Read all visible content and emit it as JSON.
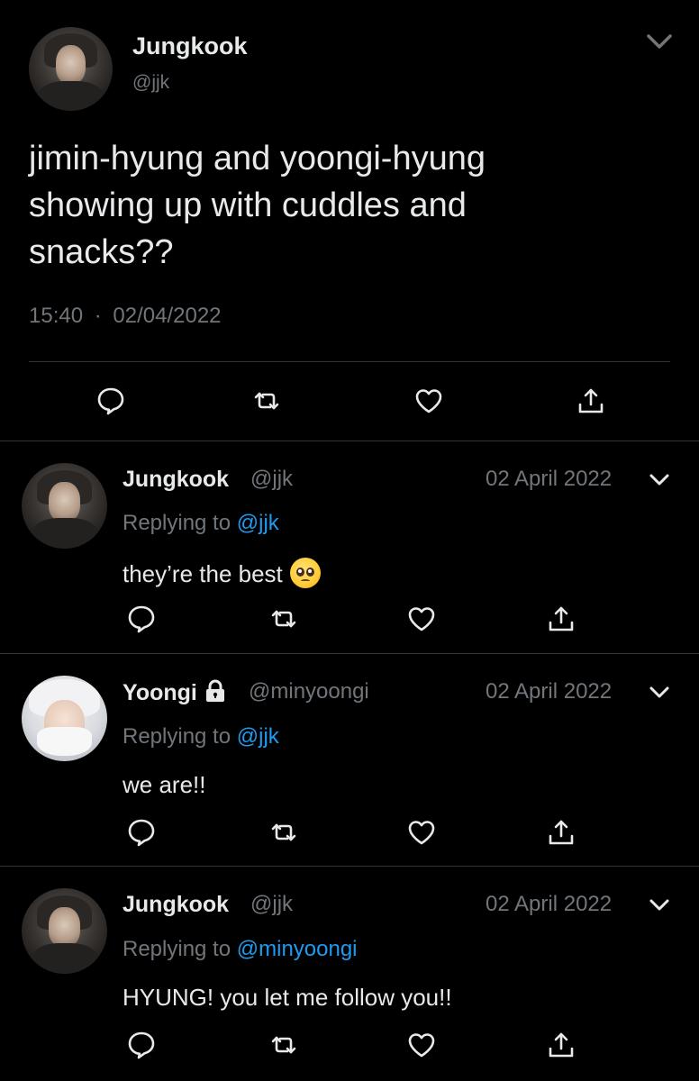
{
  "main_tweet": {
    "author_name": "Jungkook",
    "author_handle": "@jjk",
    "text_lines": [
      "jimin-hyung and yoongi-hyung",
      "showing up with cuddles and",
      "snacks??"
    ],
    "time": "15:40",
    "separator": "·",
    "date": "02/04/2022",
    "actions": [
      "reply-icon",
      "retweet-icon",
      "like-icon",
      "share-icon"
    ]
  },
  "replies": [
    {
      "author_name": "Jungkook",
      "author_handle": "@jjk",
      "locked": false,
      "date": "02 April 2022",
      "replying_prefix": "Replying to ",
      "replying_to": "@jjk",
      "text": "they’re the best",
      "emoji": "pleading-face-emoji"
    },
    {
      "author_name": "Yoongi",
      "author_handle": "@minyoongi",
      "locked": true,
      "date": "02 April 2022",
      "replying_prefix": "Replying to ",
      "replying_to": "@jjk",
      "text": "we are!!"
    },
    {
      "author_name": "Jungkook",
      "author_handle": "@jjk",
      "locked": false,
      "date": "02 April 2022",
      "replying_prefix": "Replying to ",
      "replying_to": "@minyoongi",
      "text": "HYUNG! you let me follow you!!"
    }
  ],
  "colors": {
    "background": "#000000",
    "text": "#e7e9ea",
    "secondary": "#71767b",
    "link": "#1d9bf0",
    "divider": "#2f3336"
  }
}
